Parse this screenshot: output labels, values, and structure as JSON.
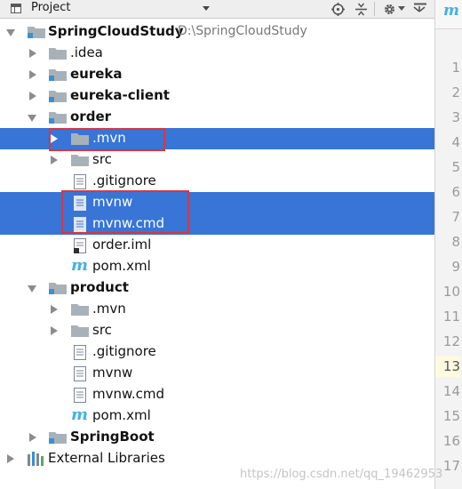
{
  "header": {
    "title": "Project"
  },
  "editor": {
    "tab_icon": "m",
    "line_numbers": [
      "1",
      "2",
      "3",
      "4",
      "5",
      "6",
      "7",
      "8",
      "9",
      "10",
      "11",
      "12",
      "13",
      "14",
      "15",
      "16",
      "17"
    ],
    "current_line": "13"
  },
  "tree": {
    "root": {
      "label": "SpringCloudStudy",
      "path": "D:\\SpringCloudStudy"
    },
    "idea": ".idea",
    "eureka": "eureka",
    "eureka_client": "eureka-client",
    "order": {
      "label": "order",
      "mvn": ".mvn",
      "src": "src",
      "gitignore": ".gitignore",
      "mvnw": "mvnw",
      "mvnw_cmd": "mvnw.cmd",
      "iml": "order.iml",
      "pom": "pom.xml"
    },
    "product": {
      "label": "product",
      "mvn": ".mvn",
      "src": "src",
      "gitignore": ".gitignore",
      "mvnw": "mvnw",
      "mvnw_cmd": "mvnw.cmd",
      "pom": "pom.xml"
    },
    "springboot": "SpringBoot",
    "external_libraries": "External Libraries"
  },
  "watermark": "https://blog.csdn.net/qq_19462953",
  "colors": {
    "selection": "#3875d7",
    "highlight_box": "#d9363e",
    "maven_icon": "#45b0e5"
  }
}
